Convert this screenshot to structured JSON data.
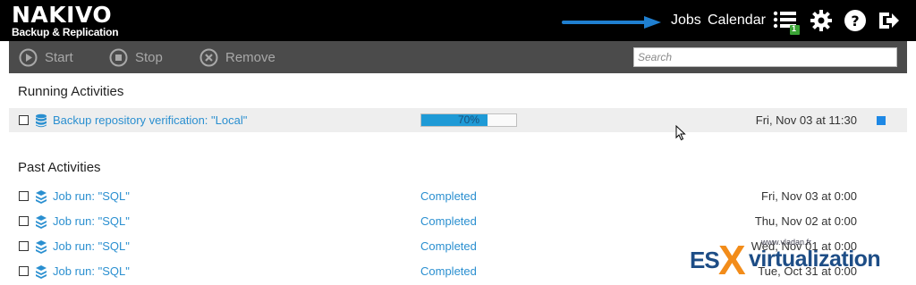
{
  "header": {
    "logo_main": "NAKIVO",
    "logo_sub": "Backup & Replication",
    "nav": {
      "jobs": "Jobs",
      "calendar": "Calendar"
    },
    "activities_badge": "1"
  },
  "toolbar": {
    "start_label": "Start",
    "stop_label": "Stop",
    "remove_label": "Remove",
    "search_placeholder": "Search"
  },
  "running": {
    "title": "Running Activities",
    "items": [
      {
        "name": "Backup repository verification: \"Local\"",
        "progress_text": "70%",
        "progress": 0.7,
        "date": "Fri, Nov 03 at 11:30"
      }
    ]
  },
  "past": {
    "title": "Past Activities",
    "items": [
      {
        "name": "Job run: \"SQL\"",
        "status": "Completed",
        "date": "Fri, Nov 03 at 0:00"
      },
      {
        "name": "Job run: \"SQL\"",
        "status": "Completed",
        "date": "Thu, Nov 02 at 0:00"
      },
      {
        "name": "Job run: \"SQL\"",
        "status": "Completed",
        "date": "Wed, Nov 01 at 0:00"
      },
      {
        "name": "Job run: \"SQL\"",
        "status": "Completed",
        "date": "Tue, Oct 31 at 0:00"
      }
    ]
  },
  "watermark": {
    "site": "www.vladan.fr",
    "es": "ES",
    "x": "X",
    "rest": "virtualization"
  },
  "colors": {
    "header_bg": "#000000",
    "toolbar_bg": "#4b4b4b",
    "link": "#2a8fd0",
    "progress": "#1e9ad6",
    "annotation_arrow": "#1f7fd0"
  }
}
